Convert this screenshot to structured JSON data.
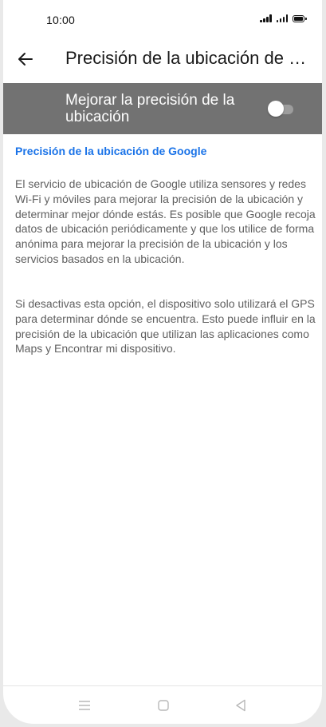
{
  "status_bar": {
    "time": "10:00"
  },
  "header": {
    "title": "Precisión de la ubicación de Google"
  },
  "setting": {
    "label": "Mejorar la precisión de la ubicación",
    "enabled": false
  },
  "content": {
    "section_title": "Precisión de la ubicación de Google",
    "paragraph1": "El servicio de ubicación de Google utiliza sensores y redes Wi-Fi y móviles para mejorar la precisión de la ubicación y determinar mejor dónde estás. Es posible que Google recoja datos de ubicación periódicamente y que los utilice de forma anónima para mejorar la precisión de la ubicación y los servicios basados en la ubicación.",
    "paragraph2": "Si desactivas esta opción, el dispositivo solo utilizará el GPS para determinar dónde se encuentra. Esto puede influir en la precisión de la ubicación que utilizan las aplicaciones como Maps y Encontrar mi dispositivo."
  },
  "colors": {
    "accent": "#1a73e8",
    "toggle_row_bg": "#727272",
    "body_text": "#5f5f5f"
  },
  "icons": {
    "back": "arrow-left",
    "nav": [
      "menu",
      "home-square",
      "back-triangle"
    ]
  }
}
